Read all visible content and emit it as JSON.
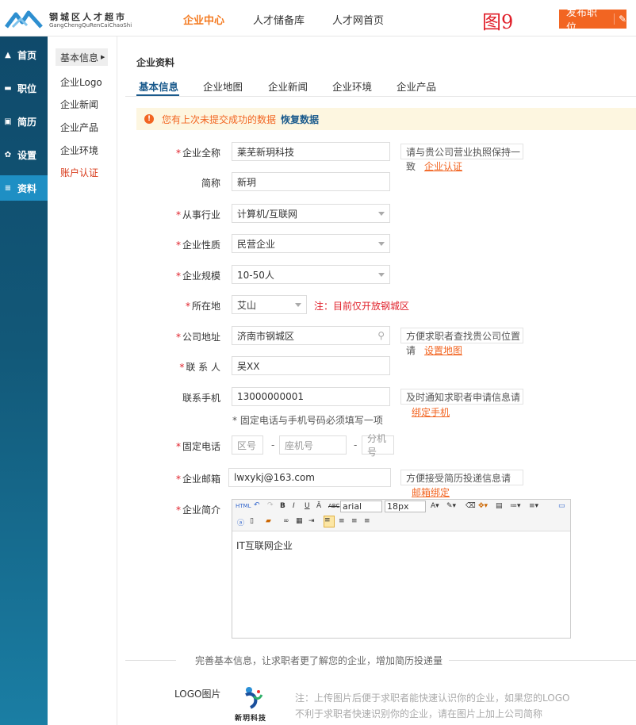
{
  "header": {
    "logo_title": "钢城区人才超市",
    "logo_sub": "GangChengQuRenCaiChaoShi",
    "nav": [
      "企业中心",
      "人才储备库",
      "人才网首页"
    ],
    "figure_label": "图9",
    "publish_label": "发布职位",
    "colors": {
      "accent": "#f26522",
      "brand": "#1a5a8c",
      "sidebar": "#125878"
    }
  },
  "sidebar": {
    "items": [
      {
        "label": "首页",
        "icon": "home-icon"
      },
      {
        "label": "职位",
        "icon": "briefcase-icon"
      },
      {
        "label": "简历",
        "icon": "id-card-icon"
      },
      {
        "label": "设置",
        "icon": "gear-icon"
      },
      {
        "label": "资料",
        "icon": "document-icon"
      }
    ]
  },
  "submenu": {
    "head": "基本信息",
    "items": [
      "企业Logo",
      "企业新闻",
      "企业产品",
      "企业环境",
      "账户认证"
    ]
  },
  "main": {
    "title": "企业资料",
    "tabs": [
      "基本信息",
      "企业地图",
      "企业新闻",
      "企业环境",
      "企业产品"
    ],
    "notice": {
      "message": "您有上次未提交成功的数据",
      "action": "恢复数据"
    }
  },
  "form": {
    "company_name": {
      "label": "企业全称",
      "value": "莱芜新玥科技",
      "tip_line1": "请与贵公司营业执照保持一",
      "tip_line2": "致",
      "tip_link": "企业认证"
    },
    "short_name": {
      "label": "简称",
      "value": "新玥"
    },
    "industry": {
      "label": "从事行业",
      "value": "计算机/互联网"
    },
    "nature": {
      "label": "企业性质",
      "value": "民营企业"
    },
    "scale": {
      "label": "企业规模",
      "value": "10-50人"
    },
    "location": {
      "label": "所在地",
      "value": "艾山",
      "note": "注：目前仅开放钢城区"
    },
    "address": {
      "label": "公司地址",
      "value": "济南市钢城区",
      "tip_line1": "方便求职者查找贵公司位置",
      "tip_line2": "请",
      "tip_link": "设置地图"
    },
    "contact": {
      "label": "联 系 人",
      "value": "吴XX"
    },
    "mobile": {
      "label": "联系手机",
      "value": "13000000001",
      "tip_line1": "及时通知求职者申请信息请",
      "tip_link": "绑定手机",
      "hint": "* 固定电话与手机号码必须填写一项"
    },
    "phone": {
      "label": "固定电话",
      "area_placeholder": "区号",
      "number_placeholder": "座机号",
      "ext_placeholder": "分机号",
      "separator": "-"
    },
    "email": {
      "label": "企业邮箱",
      "value": "lwxykj@163.com",
      "tip_line1": "方便接受简历投递信息请",
      "tip_link": "邮箱绑定"
    },
    "intro": {
      "label": "企业简介",
      "font": "arial",
      "size": "18px",
      "content": "IT互联网企业"
    }
  },
  "footer": {
    "divider_text": "完善基本信息，让求职者更了解您的企业，增加简历投递量",
    "logo_label": "LOGO图片",
    "logo_text": "新玥科技",
    "logo_note_line1": "注：上传图片后便于求职者能快速认识你的企业，如果您的LOGO",
    "logo_note_line2": "不利于求职者快速识别你的企业，请在图片上加上公司简称"
  }
}
